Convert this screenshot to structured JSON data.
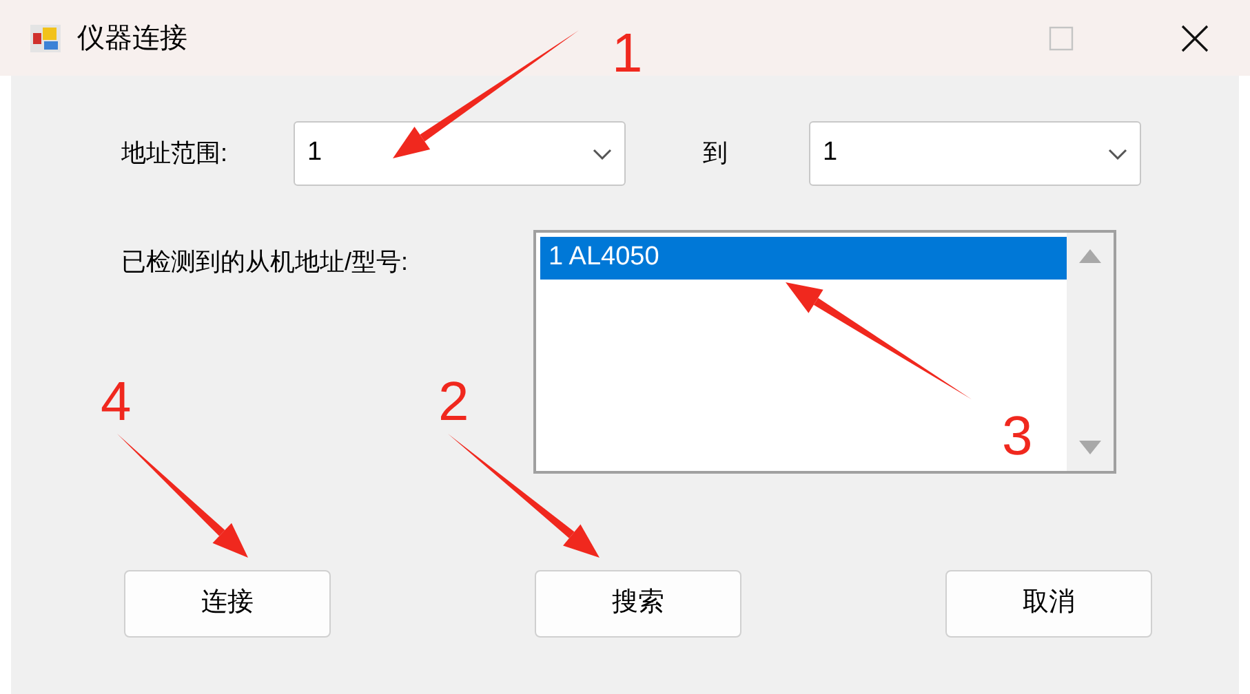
{
  "window": {
    "title": "仪器连接",
    "maximize_disabled": true
  },
  "address_range": {
    "label": "地址范围:",
    "from": "1",
    "to_label": "到",
    "to": "1"
  },
  "detected": {
    "label": "已检测到的从机地址/型号:",
    "items": [
      {
        "text": "1 AL4050",
        "selected": true
      }
    ]
  },
  "buttons": [
    "连接",
    "搜索",
    "取消"
  ],
  "annotations": [
    {
      "label": "1"
    },
    {
      "label": "2"
    },
    {
      "label": "3"
    },
    {
      "label": "4"
    }
  ]
}
